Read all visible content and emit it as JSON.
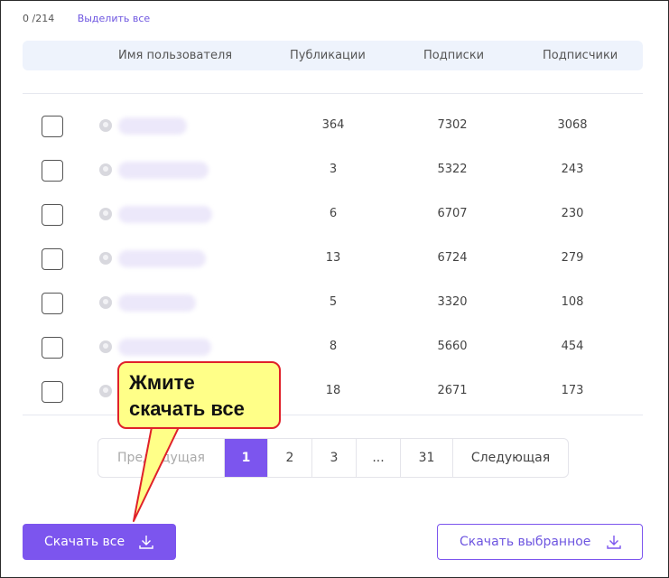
{
  "topbar": {
    "count": "0 /214",
    "select_all": "Выделить все"
  },
  "header": {
    "username": "Имя пользователя",
    "publications": "Публикации",
    "subscriptions": "Подписки",
    "followers": "Подписчики"
  },
  "rows": [
    {
      "publications": "364",
      "subscriptions": "7302",
      "followers": "3068"
    },
    {
      "publications": "3",
      "subscriptions": "5322",
      "followers": "243"
    },
    {
      "publications": "6",
      "subscriptions": "6707",
      "followers": "230"
    },
    {
      "publications": "13",
      "subscriptions": "6724",
      "followers": "279"
    },
    {
      "publications": "5",
      "subscriptions": "3320",
      "followers": "108"
    },
    {
      "publications": "8",
      "subscriptions": "5660",
      "followers": "454"
    },
    {
      "publications": "18",
      "subscriptions": "2671",
      "followers": "173"
    }
  ],
  "pagination": {
    "prev": "Предыдущая",
    "pages": [
      "1",
      "2",
      "3",
      "...",
      "31"
    ],
    "next": "Следующая",
    "active_page": "1"
  },
  "buttons": {
    "download_all": "Скачать все",
    "download_selected": "Скачать выбранное"
  },
  "callout": {
    "line1": "Жмите",
    "line2": "скачать все"
  },
  "colors": {
    "accent": "#7c55ee",
    "header_bg": "#eef3fc",
    "callout_bg": "#ffff88",
    "callout_border": "#e0212a"
  },
  "icons": {
    "download": "download-arrow-icon",
    "avatar": "user-avatar-icon"
  }
}
